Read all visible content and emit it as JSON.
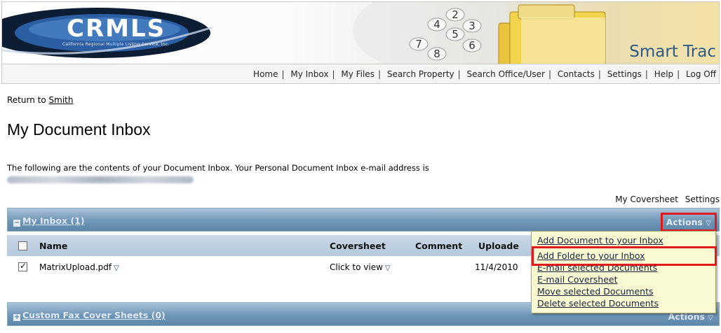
{
  "banner": {
    "logo_text": "CRMLS",
    "logo_tagline": "California Regional Multiple Listing Service, Inc.",
    "brand_label": "Smart Trac",
    "keypad_digits": [
      "2",
      "3",
      "4",
      "5",
      "6",
      "7",
      "8"
    ]
  },
  "nav": {
    "items": [
      "Home",
      "My Inbox",
      "My Files",
      "Search Property",
      "Search Office/User",
      "Contacts",
      "Settings",
      "Help",
      "Log Off"
    ],
    "separator": "|"
  },
  "page": {
    "return_prefix": "Return to",
    "return_link": "Smith",
    "title": "My Document Inbox",
    "intro": "The following are the contents of your Document Inbox. Your Personal Document Inbox e-mail address is",
    "coversheet_link": "My Coversheet",
    "settings_link": "Settings"
  },
  "inbox": {
    "title": "My Inbox (1)",
    "expander": "−",
    "actions_label": "Actions",
    "actions_icon": "▽",
    "columns": [
      "Name",
      "Coversheet",
      "Comment",
      "Uploade"
    ],
    "rows": [
      {
        "checked": true,
        "name": "MatrixUpload.pdf",
        "coversheet": "Click to view",
        "comment": "",
        "uploaded": "11/4/2010"
      }
    ]
  },
  "fax_panel": {
    "title": "Custom Fax Cover Sheets (0)",
    "expander": "+",
    "actions_label": "Actions",
    "actions_icon": "▽"
  },
  "actions_menu": {
    "items": [
      "Add Document to your Inbox",
      "Add Folder to your Inbox",
      "E-mail selected Documents",
      "E-mail Coversheet",
      "Move selected Documents",
      "Delete selected Documents"
    ],
    "highlighted_index": 1
  },
  "colors": {
    "panel_header": "#6f96b6",
    "column_header": "#c9d7e6",
    "menu_background": "#fafad2",
    "highlight": "#e01a1a",
    "brand_text": "#2e5a86"
  }
}
